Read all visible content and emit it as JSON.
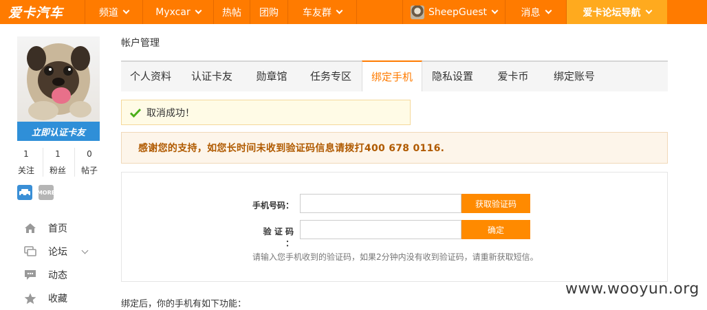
{
  "topbar": {
    "logo": "爱卡汽车",
    "nav": [
      {
        "label": "频道",
        "has_dropdown": true
      },
      {
        "label": "Myxcar",
        "has_dropdown": true
      },
      {
        "label": "热帖",
        "has_dropdown": false
      },
      {
        "label": "团购",
        "has_dropdown": false
      },
      {
        "label": "车友群",
        "has_dropdown": true
      }
    ],
    "user": "SheepGuest",
    "messages": "消息",
    "guide": "爱卡论坛导航"
  },
  "sidebar": {
    "verify_banner": "立即认证卡友",
    "stats": [
      {
        "num": "1",
        "label": "关注"
      },
      {
        "num": "1",
        "label": "粉丝"
      },
      {
        "num": "0",
        "label": "帖子"
      }
    ],
    "badges": [
      "MORE"
    ],
    "nav": [
      {
        "label": "首页",
        "icon": "home-icon"
      },
      {
        "label": "论坛",
        "icon": "forum-icon"
      },
      {
        "label": "动态",
        "icon": "activity-icon"
      },
      {
        "label": "收藏",
        "icon": "star-icon"
      }
    ]
  },
  "main": {
    "breadcrumb": "帐户管理",
    "tabs": [
      {
        "label": "个人资料",
        "active": false
      },
      {
        "label": "认证卡友",
        "active": false
      },
      {
        "label": "勋章馆",
        "active": false
      },
      {
        "label": "任务专区",
        "active": false
      },
      {
        "label": "绑定手机",
        "active": true
      },
      {
        "label": "隐私设置",
        "active": false
      },
      {
        "label": "爱卡币",
        "active": false
      },
      {
        "label": "绑定账号",
        "active": false
      }
    ],
    "success_message": "取消成功！",
    "notice": "感谢您的支持，如您长时间未收到验证码信息请拨打400 678 0116.",
    "form": {
      "phone_label": "手机号码：",
      "phone_value": "",
      "get_code_button": "获取验证码",
      "code_label": "验 证 码 ：",
      "code_value": "",
      "confirm_button": "确定",
      "hint": "请输入您手机收到的验证码，如果2分钟内没有收到验证码，请重新获取短信。"
    },
    "after_bind": "绑定后，你的手机有如下功能："
  },
  "watermark": "www.wooyun.org",
  "colors": {
    "brand": "#ff7b00",
    "guide": "#ffaa1e",
    "verify_blue": "#2f8fd8",
    "button": "#ff8a00"
  }
}
